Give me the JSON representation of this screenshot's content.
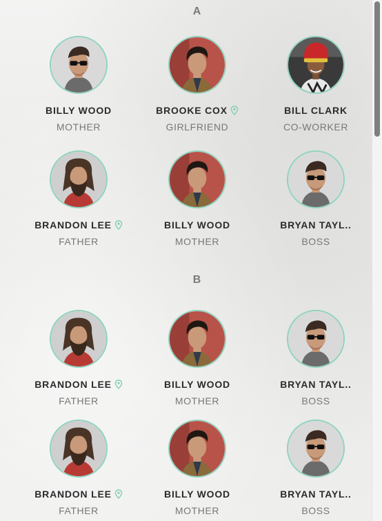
{
  "sections": [
    {
      "letter": "A",
      "contacts": [
        {
          "name": "BILLY WOOD",
          "role": "MOTHER",
          "location": false,
          "avatar": "portrait-sunglasses-icon",
          "bg": "#d9d9d9"
        },
        {
          "name": "BROOKE COX",
          "role": "GIRLFRIEND",
          "location": true,
          "avatar": "portrait-dark-hair-icon",
          "bg": "#b8534a"
        },
        {
          "name": "BILL CLARK",
          "role": "CO-WORKER",
          "location": false,
          "avatar": "portrait-red-beanie-icon",
          "bg": "#3a3a3a"
        },
        {
          "name": "BRANDON LEE",
          "role": "FATHER",
          "location": true,
          "avatar": "portrait-long-hair-beard-icon",
          "bg": "#cfcfcf"
        },
        {
          "name": "BILLY WOOD",
          "role": "MOTHER",
          "location": false,
          "avatar": "portrait-dark-hair-icon",
          "bg": "#b8534a"
        },
        {
          "name": "BRYAN TAYL..",
          "role": "BOSS",
          "location": false,
          "avatar": "portrait-sunglasses-icon",
          "bg": "#d9d9d9"
        }
      ]
    },
    {
      "letter": "B",
      "contacts": [
        {
          "name": "BRANDON LEE",
          "role": "FATHER",
          "location": true,
          "avatar": "portrait-long-hair-beard-icon",
          "bg": "#cfcfcf"
        },
        {
          "name": "BILLY WOOD",
          "role": "MOTHER",
          "location": false,
          "avatar": "portrait-dark-hair-icon",
          "bg": "#b8534a"
        },
        {
          "name": "BRYAN TAYL..",
          "role": "BOSS",
          "location": false,
          "avatar": "portrait-sunglasses-icon",
          "bg": "#d9d9d9"
        },
        {
          "name": "BRANDON LEE",
          "role": "FATHER",
          "location": true,
          "avatar": "portrait-long-hair-beard-icon",
          "bg": "#cfcfcf"
        },
        {
          "name": "BILLY WOOD",
          "role": "MOTHER",
          "location": false,
          "avatar": "portrait-dark-hair-icon",
          "bg": "#b8534a"
        },
        {
          "name": "BRYAN TAYL..",
          "role": "BOSS",
          "location": false,
          "avatar": "portrait-sunglasses-icon",
          "bg": "#d9d9d9"
        }
      ]
    }
  ],
  "colors": {
    "accent": "#8fd3bf",
    "pin": "#7fcfb4"
  }
}
